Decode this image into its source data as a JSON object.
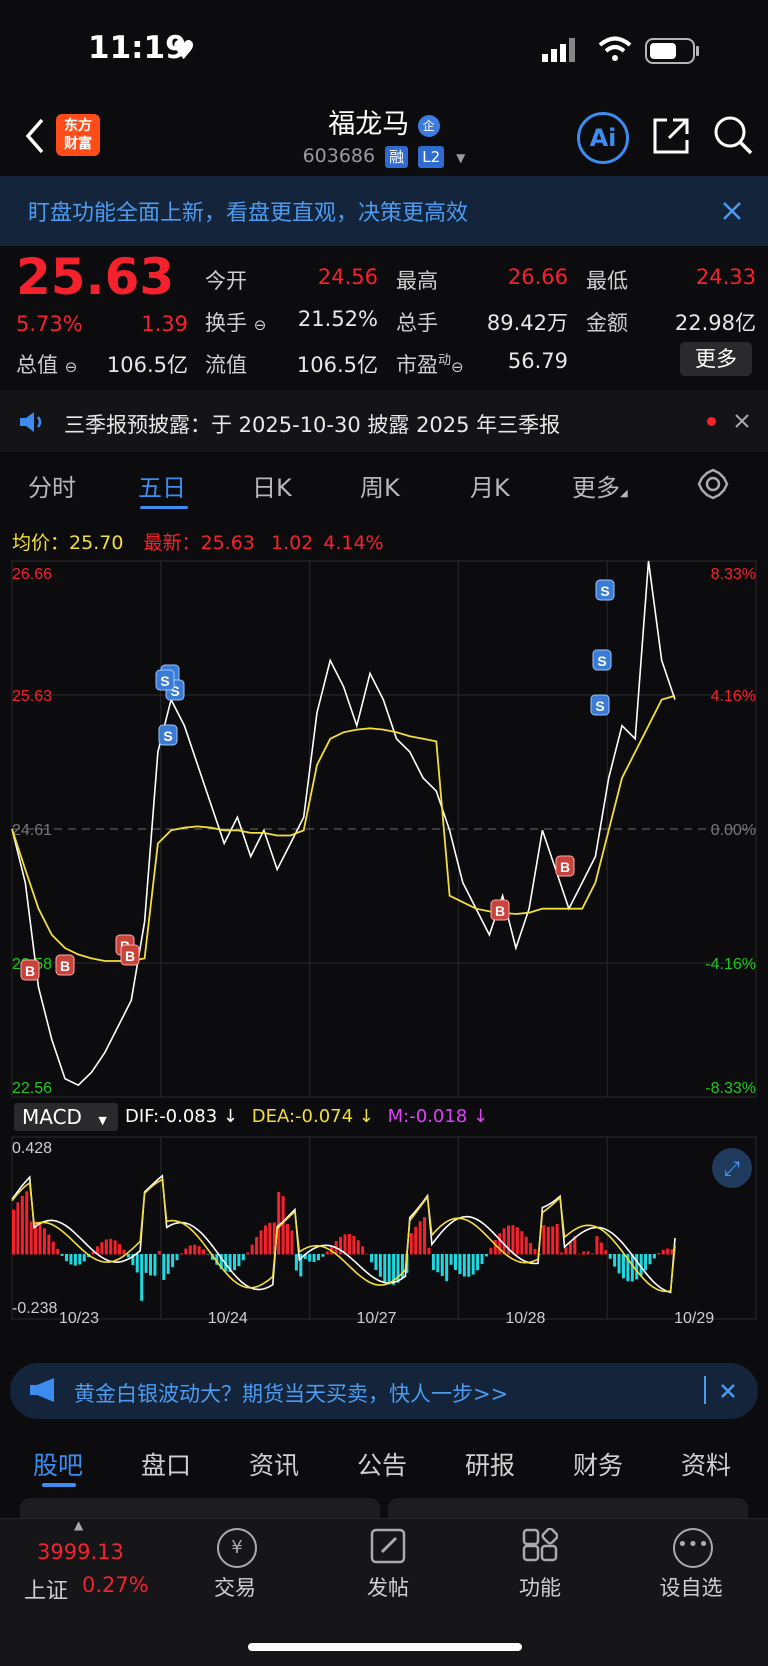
{
  "status": {
    "time": "11:19"
  },
  "header": {
    "logo_line1": "东方",
    "logo_line2": "财富",
    "stock_name": "福龙马",
    "name_badge": "企",
    "stock_code": "603686",
    "badge_margin": "融",
    "badge_level": "L2",
    "ai_label": "Ai"
  },
  "banner": {
    "text": "盯盘功能全面上新，看盘更直观，决策更高效"
  },
  "quote": {
    "price": "25.63",
    "change_pct": "5.73%",
    "change_amt": "1.39",
    "open_label": "今开",
    "open": "24.56",
    "high_label": "最高",
    "high": "26.66",
    "low_label": "最低",
    "low": "24.33",
    "turnover_label": "换手",
    "turnover": "21.52%",
    "volume_label": "总手",
    "volume": "89.42万",
    "amount_label": "金额",
    "amount": "22.98亿",
    "mcap_label": "总值",
    "mcap": "106.5亿",
    "float_label": "流值",
    "float_cap": "106.5亿",
    "pe_label": "市盈",
    "pe_sup": "动",
    "pe": "56.79",
    "more_label": "更多"
  },
  "notice": {
    "text": "三季报预披露：于 2025-10-30 披露 2025 年三季报"
  },
  "chart_tabs": [
    "分时",
    "五日",
    "日K",
    "周K",
    "月K",
    "更多"
  ],
  "chart_tab_active": "五日",
  "chart_info": {
    "avg_label": "均价：",
    "avg_value": "25.70",
    "latest_label": "最新：",
    "latest_value": "25.63",
    "latest_change": "1.02",
    "latest_pct": "4.14%"
  },
  "chart_data": [
    {
      "type": "line",
      "x_labels": [
        "10/23",
        "10/24",
        "10/27",
        "10/28",
        "10/29"
      ],
      "ylim": [
        22.56,
        26.66
      ],
      "y_ticks_left": [
        "26.66",
        "25.63",
        "24.61",
        "23.58",
        "22.56"
      ],
      "y_ticks_right": [
        "8.33%",
        "4.16%",
        "0.00%",
        "-4.16%",
        "-8.33%"
      ],
      "series": [
        {
          "name": "最新",
          "color": "#ffffff",
          "values": [
            24.61,
            24.2,
            23.4,
            23.0,
            22.7,
            22.65,
            22.75,
            22.9,
            23.1,
            23.3,
            23.9,
            25.2,
            25.6,
            25.4,
            25.1,
            24.8,
            24.5,
            24.7,
            24.4,
            24.6,
            24.3,
            24.5,
            24.7,
            25.5,
            25.9,
            25.7,
            25.4,
            25.8,
            25.6,
            25.3,
            25.2,
            25.0,
            24.9,
            24.6,
            24.2,
            24.0,
            23.8,
            24.1,
            23.7,
            24.0,
            24.6,
            24.3,
            24.0,
            24.2,
            24.4,
            25.0,
            25.4,
            25.3,
            26.7,
            25.9,
            25.6
          ]
        },
        {
          "name": "均价",
          "color": "#f2de3a",
          "values": [
            24.61,
            24.3,
            24.0,
            23.8,
            23.7,
            23.65,
            23.62,
            23.6,
            23.6,
            23.6,
            23.62,
            24.5,
            24.6,
            24.62,
            24.63,
            24.62,
            24.6,
            24.6,
            24.58,
            24.58,
            24.56,
            24.56,
            24.6,
            25.1,
            25.3,
            25.35,
            25.37,
            25.38,
            25.37,
            25.35,
            25.32,
            25.3,
            25.28,
            24.1,
            24.05,
            24.0,
            23.98,
            23.97,
            23.96,
            23.97,
            24.0,
            24.0,
            24.0,
            24.0,
            24.2,
            24.6,
            25.0,
            25.2,
            25.4,
            25.6,
            25.63
          ]
        }
      ],
      "trade_markers": [
        "B",
        "B",
        "B",
        "B",
        "S",
        "S",
        "S",
        "S",
        "B",
        "B",
        "S",
        "S",
        "S"
      ]
    },
    {
      "type": "line",
      "indicator": "MACD",
      "ylim": [
        -0.238,
        0.428
      ],
      "y_ticks": [
        "0.428",
        "-0.238"
      ],
      "dif_label": "DIF:-0.083 ↓",
      "dea_label": "DEA:-0.074 ↓",
      "m_label": "M:-0.018 ↓",
      "series": [
        {
          "name": "DIF",
          "color": "#ffffff"
        },
        {
          "name": "DEA",
          "color": "#f2de3a"
        }
      ]
    }
  ],
  "promo": {
    "text": "黄金白银波动大？期货当天买卖，快人一步>>"
  },
  "bottom_tabs": [
    "股吧",
    "盘口",
    "资讯",
    "公告",
    "研报",
    "财务",
    "资料"
  ],
  "tabbar": {
    "index_value": "3999.13",
    "index_name": "上证",
    "index_pct": "0.27%",
    "items": [
      "交易",
      "发帖",
      "功能",
      "设自选"
    ]
  },
  "colors": {
    "up": "#f5222d",
    "down": "#1fc81f",
    "accent": "#3d8cf0",
    "avg": "#f2de3a"
  }
}
